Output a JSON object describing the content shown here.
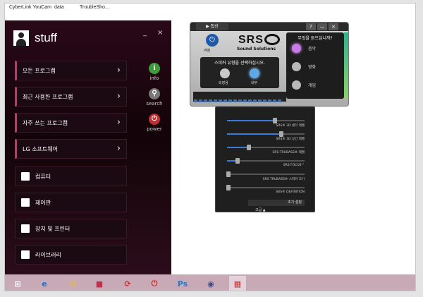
{
  "desktop_icons": [
    {
      "label": "CyberLink YouCam"
    },
    {
      "label": "data"
    },
    {
      "label": "TroubleSho..."
    }
  ],
  "start_menu": {
    "user_name": "stuff",
    "minimize_label": "_",
    "close_label": "×",
    "categories": [
      {
        "label": "모든 프로그램"
      },
      {
        "label": "최근 사용한 프로그램"
      },
      {
        "label": "자주 쓰는 프로그램"
      },
      {
        "label": "LG 소프트웨어"
      }
    ],
    "items": [
      {
        "label": "컴퓨터",
        "icon": "computer-icon"
      },
      {
        "label": "제어판",
        "icon": "control-panel-icon"
      },
      {
        "label": "장치 및 프린터",
        "icon": "printer-icon"
      },
      {
        "label": "라이브러리",
        "icon": "library-icon"
      }
    ],
    "side": [
      {
        "label": "info",
        "glyph": "i",
        "color": "#3f9a3a"
      },
      {
        "label": "search",
        "glyph": "⚲",
        "color": "#777777"
      },
      {
        "label": "power",
        "glyph": "⏻",
        "color": "#c03030"
      }
    ]
  },
  "srs": {
    "tab_label": "▶ 접선",
    "controls": [
      "?",
      "—",
      "×"
    ],
    "power_label": "켜짐",
    "logo_text": "SRS",
    "subtitle": "Sound Solutions",
    "speaker_title": "스피커 유형을 선택하십시오.",
    "speaker_options": [
      {
        "label": "외장용",
        "selected": false
      },
      {
        "label": "내부",
        "selected": true
      }
    ],
    "right_title": "무엇을 듣으십니까?",
    "modes": [
      {
        "label": "음악",
        "selected": true
      },
      {
        "label": "영화",
        "selected": false
      },
      {
        "label": "게임",
        "selected": false
      }
    ]
  },
  "srs_advanced": {
    "sliders": [
      {
        "label": "SRS® 3D 센터 레벨",
        "value": 0.62
      },
      {
        "label": "SRS® 3D 공간 레벨",
        "value": 0.7
      },
      {
        "label": "SRS TRUBASS® 레벨",
        "value": 0.28
      },
      {
        "label": "SRS FOCUS™",
        "value": 0.14
      },
      {
        "label": "SRS TRUBASS® 스피커 크기",
        "value": 0.02
      },
      {
        "label": "SRS® DEFINITION",
        "value": 0.02
      }
    ],
    "reset_label": "초기 설정",
    "advanced_label": "고급 ▲"
  },
  "taskbar": {
    "apps": [
      {
        "name": "start",
        "glyph": "⊞",
        "color": "#ffffff"
      },
      {
        "name": "internet-explorer",
        "glyph": "e",
        "color": "#1d6fd0"
      },
      {
        "name": "file-explorer",
        "glyph": "▤",
        "color": "#e8b84a"
      },
      {
        "name": "app-gallery",
        "glyph": "■",
        "color": "#c0304a"
      },
      {
        "name": "app-refresh",
        "glyph": "⟳",
        "color": "#d02a2a"
      },
      {
        "name": "app-power",
        "glyph": "⏻",
        "color": "#d02a2a"
      },
      {
        "name": "photoshop",
        "glyph": "Ps",
        "color": "#2a77c8"
      },
      {
        "name": "srs-audio",
        "glyph": "◉",
        "color": "#3a4a8a"
      },
      {
        "name": "app-grid",
        "glyph": "▦",
        "color": "#d02a2a"
      }
    ],
    "active_index": 8
  }
}
